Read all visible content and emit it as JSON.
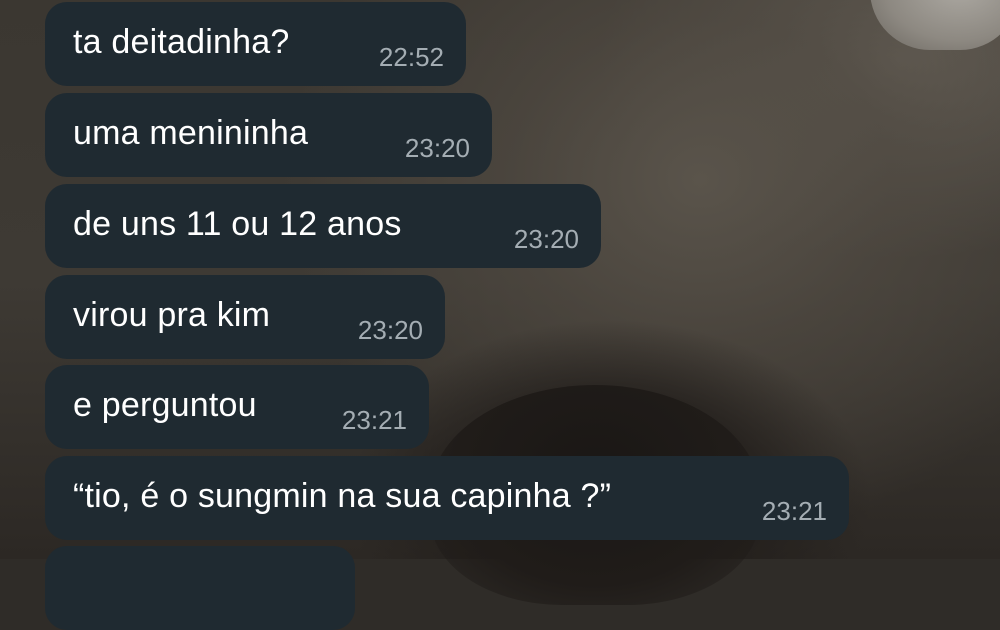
{
  "messages": [
    {
      "text": "ta deitadinha?",
      "time": "22:52"
    },
    {
      "text": "uma menininha",
      "time": "23:20"
    },
    {
      "text": "de uns 11 ou 12 anos",
      "time": "23:20"
    },
    {
      "text": "virou pra kim",
      "time": "23:20"
    },
    {
      "text": "e perguntou",
      "time": "23:21"
    },
    {
      "text": "“tio, é o sungmin na sua capinha ?”",
      "time": "23:21"
    }
  ],
  "colors": {
    "bubble_background": "#1f2a31",
    "message_text": "#ffffff",
    "timestamp_text": "#a4adb3"
  }
}
